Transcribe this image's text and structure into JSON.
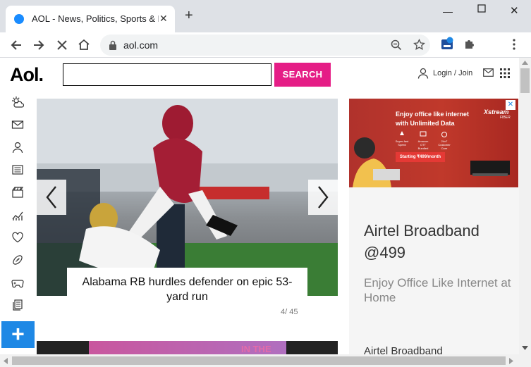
{
  "browser": {
    "tab_title": "AOL - News, Politics, Sports & La",
    "url": "aol.com"
  },
  "header": {
    "logo": "Aol.",
    "search_button": "SEARCH",
    "login": "Login / Join"
  },
  "carousel": {
    "caption": "Alabama RB hurdles defender on epic 53-yard run",
    "counter": "4/ 45"
  },
  "ad": {
    "banner_headline_line1": "Enjoy office like internet",
    "banner_headline_line2": "with Unlimited Data",
    "banner_brand": "Xstream",
    "banner_brand_sub": "FIBER",
    "banner_offer": "Starting ₹499/month",
    "feature1": "Super-fast Speed",
    "feature2": "Amazon OTT Bundled",
    "feature3": "24x7 Customer Care",
    "title": "Airtel Broadband @499",
    "subtitle": "Enjoy Office Like Internet at Home",
    "footer": "Airtel Broadband"
  },
  "colors": {
    "accent": "#e51d86",
    "fab": "#1e88e5",
    "ad_red": "#c0392b"
  },
  "icons": [
    "weather-icon",
    "mail-icon",
    "user-icon",
    "news-icon",
    "video-icon",
    "finance-icon",
    "heart-icon",
    "sports-icon",
    "games-icon",
    "pages-icon"
  ]
}
